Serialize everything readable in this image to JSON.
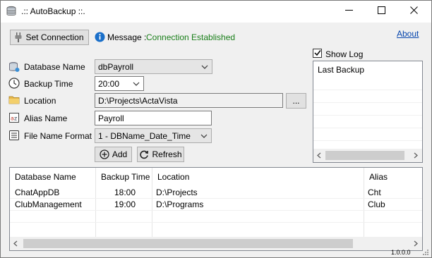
{
  "app": {
    "title": ".:: AutoBackup ::."
  },
  "toolbar": {
    "set_connection_label": "Set Connection",
    "message_label": "Message :",
    "message_value": "Connection Established",
    "about_link": "About"
  },
  "form": {
    "database_name": {
      "label": "Database Name",
      "value": "dbPayroll"
    },
    "backup_time": {
      "label": "Backup Time",
      "value": "20:00"
    },
    "location": {
      "label": "Location",
      "value": "D:\\Projects\\ActaVista",
      "browse_label": "..."
    },
    "alias_name": {
      "label": "Alias Name",
      "value": "Payroll"
    },
    "file_name_format": {
      "label": "File Name Format",
      "value": "1 - DBName_Date_Time"
    },
    "add_label": "Add",
    "refresh_label": "Refresh"
  },
  "log": {
    "show_log_label": "Show Log",
    "show_log_checked": true,
    "column_header": "Last Backup"
  },
  "grid": {
    "columns": [
      "Database Name",
      "Backup Time",
      "Location",
      "Alias"
    ],
    "rows": [
      [
        "ChatAppDB",
        "18:00",
        "D:\\Projects",
        "Cht"
      ],
      [
        "ClubManagement",
        "19:00",
        "D:\\Programs",
        "Club"
      ]
    ]
  },
  "status": {
    "version": "1.0.0.0"
  },
  "icons": {
    "app": "database-stack-icon",
    "set_connection": "plug-icon",
    "message": "info-icon",
    "database": "database-icon",
    "time": "clock-icon",
    "location": "folder-icon",
    "alias": "alias-tag-icon",
    "format": "list-format-icon",
    "add": "plus-circle-icon",
    "refresh": "refresh-icon"
  },
  "colors": {
    "status_ok": "#1a7f1a",
    "link": "#0645ad",
    "info": "#1a6fc9"
  }
}
